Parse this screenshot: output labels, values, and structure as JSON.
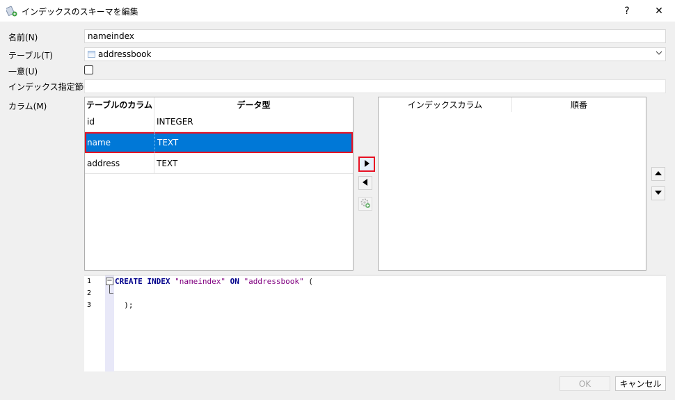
{
  "window": {
    "title": "インデックスのスキーマを編集",
    "help": "?",
    "close": "✕"
  },
  "form": {
    "name_label": "名前(N)",
    "name_value": "nameindex",
    "table_label": "テーブル(T)",
    "table_value": "addressbook",
    "unique_label": "一意(U)",
    "unique_checked": false,
    "clause_label": "インデックス指定節(X)",
    "clause_value": "",
    "columns_label": "カラム(M)"
  },
  "table_columns": {
    "headers": [
      "テーブルのカラム",
      "データ型"
    ],
    "rows": [
      {
        "name": "id",
        "type": "INTEGER"
      },
      {
        "name": "name",
        "type": "TEXT"
      },
      {
        "name": "address",
        "type": "TEXT"
      }
    ],
    "selected_index": 1
  },
  "index_columns": {
    "headers": [
      "インデックスカラム",
      "順番"
    ],
    "rows": []
  },
  "editor": {
    "line_numbers": [
      "1",
      "2",
      "3"
    ],
    "line1": {
      "kw1": "CREATE",
      "kw2": "INDEX",
      "s1": "\"nameindex\"",
      "kw3": "ON",
      "s2": "\"addressbook\"",
      "paren": "("
    },
    "line3": ");"
  },
  "buttons": {
    "ok": "OK",
    "cancel": "キャンセル"
  },
  "icons": {
    "add": "right-triangle-icon",
    "remove": "left-triangle-icon",
    "auto": "gear-add-icon",
    "up": "up-triangle-icon",
    "down": "down-triangle-icon"
  },
  "colors": {
    "selection": "#0078d7",
    "highlight_border": "#e81123",
    "keyword": "#00008b",
    "string": "#800080"
  }
}
